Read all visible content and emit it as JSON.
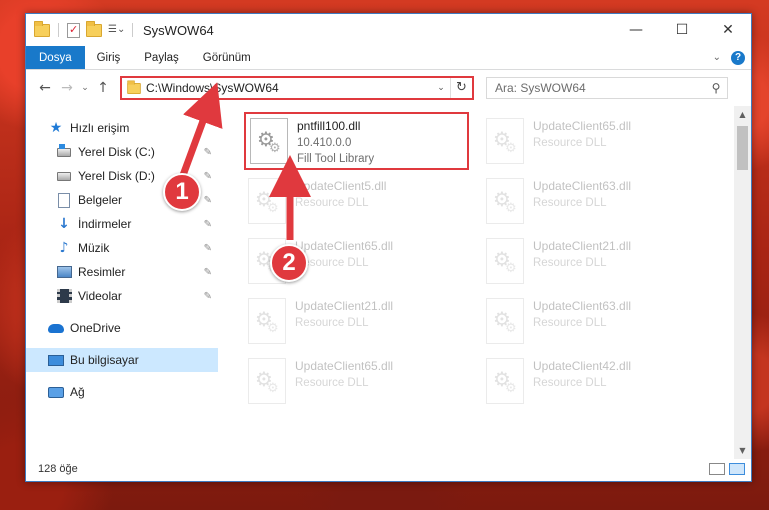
{
  "window": {
    "title": "SysWOW64",
    "controls": {
      "minimize": "—",
      "maximize": "☐",
      "close": "✕"
    }
  },
  "ribbon": {
    "tabs": [
      "Dosya",
      "Giriş",
      "Paylaş",
      "Görünüm"
    ]
  },
  "nav": {
    "back": "←",
    "forward": "→",
    "recent": "⌄",
    "up": "↑"
  },
  "address": {
    "path": "C:\\Windows\\SysWOW64",
    "dropdown": "⌄",
    "refresh": "↻"
  },
  "search": {
    "placeholder": "Ara: SysWOW64",
    "icon": "search-icon"
  },
  "sidebar": {
    "items": [
      {
        "label": "Hızlı erişim",
        "icon": "star-icon",
        "pinned": false
      },
      {
        "label": "Yerel Disk (C:)",
        "icon": "drive-c-icon",
        "pinned": true
      },
      {
        "label": "Yerel Disk (D:)",
        "icon": "drive-d-icon",
        "pinned": true
      },
      {
        "label": "Belgeler",
        "icon": "documents-icon",
        "pinned": true
      },
      {
        "label": "İndirmeler",
        "icon": "downloads-icon",
        "pinned": true
      },
      {
        "label": "Müzik",
        "icon": "music-icon",
        "pinned": true
      },
      {
        "label": "Resimler",
        "icon": "pictures-icon",
        "pinned": true
      },
      {
        "label": "Videolar",
        "icon": "videos-icon",
        "pinned": true
      },
      {
        "label": "OneDrive",
        "icon": "onedrive-icon",
        "pinned": false
      },
      {
        "label": "Bu bilgisayar",
        "icon": "this-pc-icon",
        "pinned": false,
        "selected": true
      },
      {
        "label": "Ağ",
        "icon": "network-icon",
        "pinned": false
      }
    ],
    "pin_glyph": "📌"
  },
  "files": {
    "highlighted": {
      "name": "pntfill100.dll",
      "version": "10.410.0.0",
      "description": "Fill Tool Library"
    },
    "faded": [
      {
        "name": "UpdateClient65.dll",
        "description": "Resource DLL"
      },
      {
        "name": "UpdateClient5.dll",
        "description": "Resource DLL"
      },
      {
        "name": "UpdateClient63.dll",
        "description": "Resource DLL"
      },
      {
        "name": "UpdateClient65.dll",
        "description": "Resource DLL"
      },
      {
        "name": "UpdateClient21.dll",
        "description": "Resource DLL"
      },
      {
        "name": "UpdateClient21.dll",
        "description": "Resource DLL"
      },
      {
        "name": "UpdateClient63.dll",
        "description": "Resource DLL"
      },
      {
        "name": "UpdateClient65.dll",
        "description": "Resource DLL"
      },
      {
        "name": "UpdateClient42.dll",
        "description": "Resource DLL"
      }
    ]
  },
  "status": {
    "item_count": "128 öğe"
  },
  "annotations": {
    "badge1": "1",
    "badge2": "2",
    "color": "#e0393e"
  }
}
